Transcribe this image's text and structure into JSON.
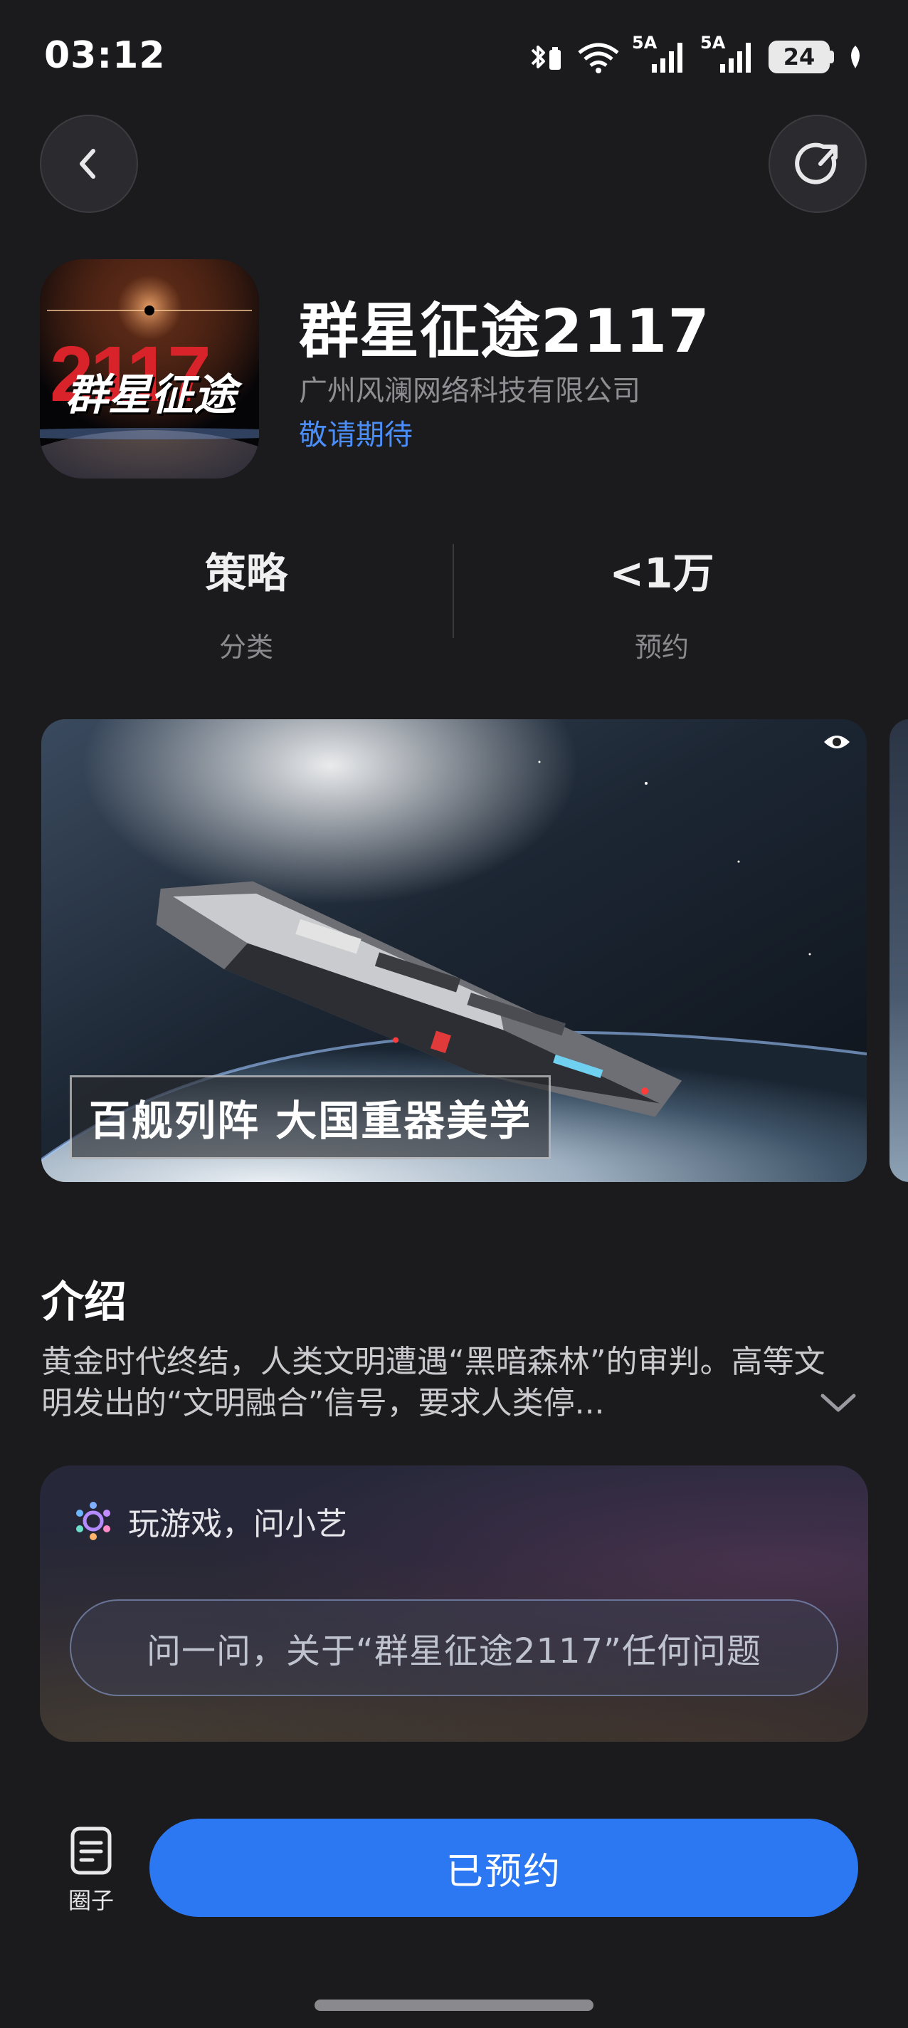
{
  "status_bar": {
    "time": "03:12",
    "network_1": "5A",
    "network_2": "5A",
    "battery": "24"
  },
  "nav": {
    "back_icon": "chevron-left-icon",
    "share_icon": "share-icon"
  },
  "app": {
    "name": "群星征途2117",
    "developer": "广州风澜网络科技有限公司",
    "status": "敬请期待",
    "icon_text_big": "2117",
    "icon_text_title": "群星征途"
  },
  "stats": [
    {
      "value": "策略",
      "label": "分类"
    },
    {
      "value": "<1万",
      "label": "预约"
    }
  ],
  "screenshot": {
    "caption": "百舰列阵 大国重器美学"
  },
  "intro": {
    "title": "介绍",
    "text": "黄金时代终结，人类文明遭遇“黑暗森林”的审判。高等文明发出的“文明融合”信号，要求人类停..."
  },
  "ai": {
    "title": "玩游戏，问小艺",
    "placeholder": "问一问，关于“群星征途2117”任何问题"
  },
  "bottom": {
    "circle_label": "圈子",
    "action_label": "已预约"
  },
  "colors": {
    "background": "#1b1b1e",
    "accent_blue": "#2c78f2",
    "link_blue": "#4b8ef8"
  }
}
